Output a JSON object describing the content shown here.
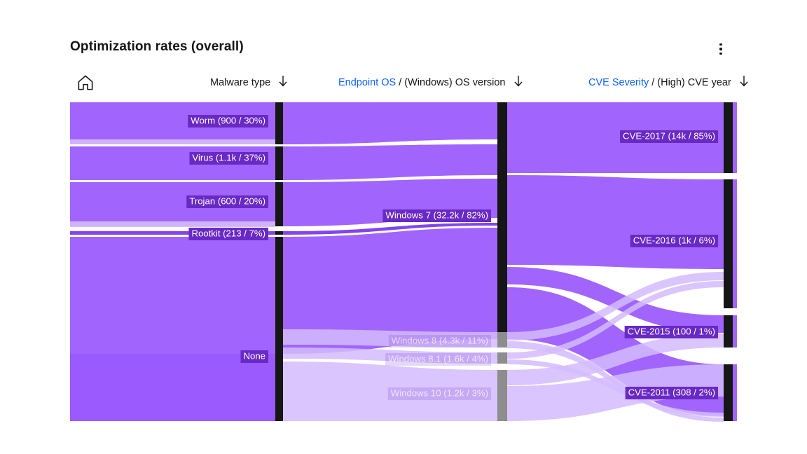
{
  "header": {
    "title": "Optimization rates (overall)",
    "overflow_menu_icon": "overflow-menu-vertical-icon"
  },
  "columns": {
    "home_icon": "home-icon",
    "sort_icon": "arrow-down-icon",
    "c1": {
      "accent": "",
      "separator": "",
      "rest": "Malware type"
    },
    "c2": {
      "accent": "Endpoint OS",
      "separator": "/",
      "rest": "(Windows) OS version"
    },
    "c3": {
      "accent": "CVE Severity",
      "separator": "/",
      "rest": "(High) CVE year"
    }
  },
  "colors": {
    "accent_link": "#0f62fe",
    "node_bar": "#161616",
    "node_bar_faded": "#8d8d8d",
    "flow_strong": "#8a3ffc",
    "flow_faded": "#d4bbff",
    "flow_deep": "#7c3aed",
    "label_chip": "#6929c4",
    "background": "#ffffff",
    "title": "#161616"
  },
  "chart_data": {
    "type": "sankey",
    "title": "Optimization rates (overall)",
    "stages": [
      "Malware type",
      "(Windows) OS version",
      "(High) CVE year"
    ],
    "nodes": [
      {
        "id": "worm",
        "stage": 0,
        "label": "Worm (900 / 30%)",
        "value": 900,
        "percent": 30,
        "faded": false
      },
      {
        "id": "virus",
        "stage": 0,
        "label": "Virus (1.1k / 37%)",
        "value": 1100,
        "percent": 37,
        "faded": false
      },
      {
        "id": "trojan",
        "stage": 0,
        "label": "Trojan (600 / 20%)",
        "value": 600,
        "percent": 20,
        "faded": false
      },
      {
        "id": "rootkit",
        "stage": 0,
        "label": "Rootkit (213 / 7%)",
        "value": 213,
        "percent": 7,
        "faded": false
      },
      {
        "id": "none",
        "stage": 0,
        "label": "None",
        "value": null,
        "percent": null,
        "faded": false
      },
      {
        "id": "win7",
        "stage": 1,
        "label": "Windows 7 (32.2k / 82%)",
        "value": 32200,
        "percent": 82,
        "faded": false
      },
      {
        "id": "win8",
        "stage": 1,
        "label": "Windows 8 (4.3k / 11%)",
        "value": 4300,
        "percent": 11,
        "faded": true
      },
      {
        "id": "win81",
        "stage": 1,
        "label": "Windows 8.1 (1.6k / 4%)",
        "value": 1600,
        "percent": 4,
        "faded": true
      },
      {
        "id": "win10",
        "stage": 1,
        "label": "Windows 10 (1.2k / 3%)",
        "value": 1200,
        "percent": 3,
        "faded": true
      },
      {
        "id": "cve2017",
        "stage": 2,
        "label": "CVE-2017 (14k / 85%)",
        "value": 14000,
        "percent": 85,
        "faded": false
      },
      {
        "id": "cve2016",
        "stage": 2,
        "label": "CVE-2016 (1k / 6%)",
        "value": 1000,
        "percent": 6,
        "faded": false
      },
      {
        "id": "cve2015",
        "stage": 2,
        "label": "CVE-2015 (100 / 1%)",
        "value": 100,
        "percent": 1,
        "faded": false
      },
      {
        "id": "cve2011",
        "stage": 2,
        "label": "CVE-2011 (308 / 2%)",
        "value": 308,
        "percent": 2,
        "faded": false
      }
    ],
    "links": [
      {
        "source": "worm",
        "target": "win7",
        "emphasis": "strong"
      },
      {
        "source": "virus",
        "target": "win7",
        "emphasis": "strong"
      },
      {
        "source": "trojan",
        "target": "win7",
        "emphasis": "strong"
      },
      {
        "source": "rootkit",
        "target": "win7",
        "emphasis": "deep"
      },
      {
        "source": "none",
        "target": "win7",
        "emphasis": "strong"
      },
      {
        "source": "none",
        "target": "win8",
        "emphasis": "faded"
      },
      {
        "source": "none",
        "target": "win81",
        "emphasis": "faded"
      },
      {
        "source": "none",
        "target": "win10",
        "emphasis": "faded"
      },
      {
        "source": "win7",
        "target": "cve2017",
        "emphasis": "strong"
      },
      {
        "source": "win7",
        "target": "cve2016",
        "emphasis": "strong"
      },
      {
        "source": "win7",
        "target": "cve2015",
        "emphasis": "strong"
      },
      {
        "source": "win7",
        "target": "cve2011",
        "emphasis": "strong"
      },
      {
        "source": "win8",
        "target": "cve2016",
        "emphasis": "faded"
      },
      {
        "source": "win8",
        "target": "cve2011",
        "emphasis": "faded"
      },
      {
        "source": "win81",
        "target": "cve2016",
        "emphasis": "faded"
      },
      {
        "source": "win81",
        "target": "cve2011",
        "emphasis": "faded"
      },
      {
        "source": "win10",
        "target": "cve2015",
        "emphasis": "faded"
      },
      {
        "source": "win10",
        "target": "cve2011",
        "emphasis": "faded"
      }
    ]
  }
}
